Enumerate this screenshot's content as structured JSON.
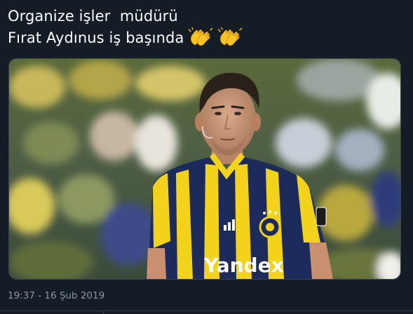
{
  "tweet": {
    "text_line_1": "Organize işler  müdürü",
    "text_line_2": "Fırat Aydınus iş başında",
    "emojis": [
      "clapping-hands",
      "clapping-hands"
    ],
    "image": {
      "description_icon": "photo",
      "shirt_text": "Yandex"
    },
    "timestamp": "19:37 - 16 Şub 2019"
  },
  "colors": {
    "background": "#141d26",
    "text": "#ffffff",
    "muted": "#8899a6",
    "border": "#38444d",
    "shirt_navy": "#1c2a5c",
    "shirt_yellow": "#f2d21b",
    "emoji_yellow": "#f7c325"
  }
}
